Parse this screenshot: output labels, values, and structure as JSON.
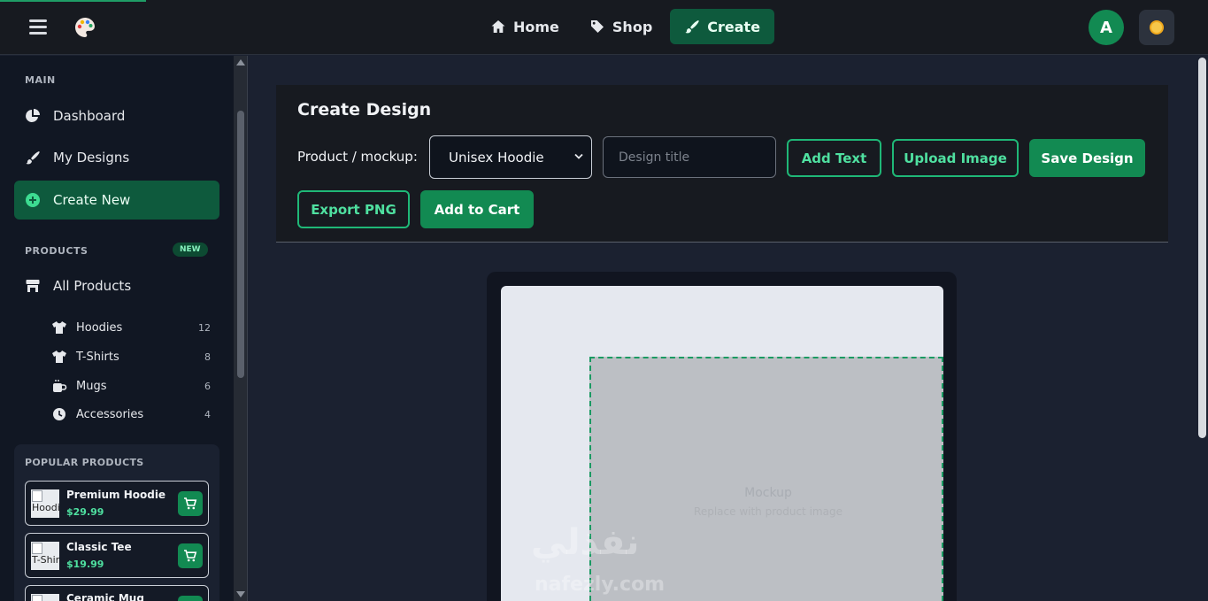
{
  "nav": {
    "home": "Home",
    "shop": "Shop",
    "create": "Create",
    "avatar_initial": "A"
  },
  "sidebar": {
    "main_label": "MAIN",
    "items": [
      {
        "label": "Dashboard",
        "icon": "chart-pie-icon"
      },
      {
        "label": "My Designs",
        "icon": "paintbrush-icon"
      },
      {
        "label": "Create New",
        "icon": "plus-circle-icon"
      }
    ],
    "products_label": "PRODUCTS",
    "new_badge": "NEW",
    "all_products": "All Products",
    "categories": [
      {
        "label": "Hoodies",
        "count": "12",
        "icon": "shirt-icon"
      },
      {
        "label": "T-Shirts",
        "count": "8",
        "icon": "shirt-icon"
      },
      {
        "label": "Mugs",
        "count": "6",
        "icon": "mug-icon"
      },
      {
        "label": "Accessories",
        "count": "4",
        "icon": "clock-icon"
      }
    ],
    "popular_label": "POPULAR PRODUCTS",
    "popular": [
      {
        "name": "Premium Hoodie",
        "price": "$29.99",
        "thumb_alt": "Hoodie"
      },
      {
        "name": "Classic Tee",
        "price": "$19.99",
        "thumb_alt": "T-Shirt"
      },
      {
        "name": "Ceramic Mug",
        "price": "",
        "thumb_alt": ""
      }
    ]
  },
  "editor": {
    "title": "Create Design",
    "mockup_label": "Product / mockup:",
    "mockup_selected": "Unisex Hoodie",
    "design_title_placeholder": "Design title",
    "add_text": "Add Text",
    "upload_image": "Upload Image",
    "save_design": "Save Design",
    "export_png": "Export PNG",
    "add_to_cart": "Add to Cart",
    "canvas_placeholder_title": "Mockup",
    "canvas_placeholder_sub": "Replace with product image"
  },
  "watermark": {
    "arabic": "نفذلي",
    "latin": "nafezly.com"
  },
  "colors": {
    "accent": "#128a52",
    "accent_dark": "#0e5a3d",
    "accent_text": "#4fe0a0",
    "bg": "#1b2130",
    "panel": "#171a20"
  }
}
